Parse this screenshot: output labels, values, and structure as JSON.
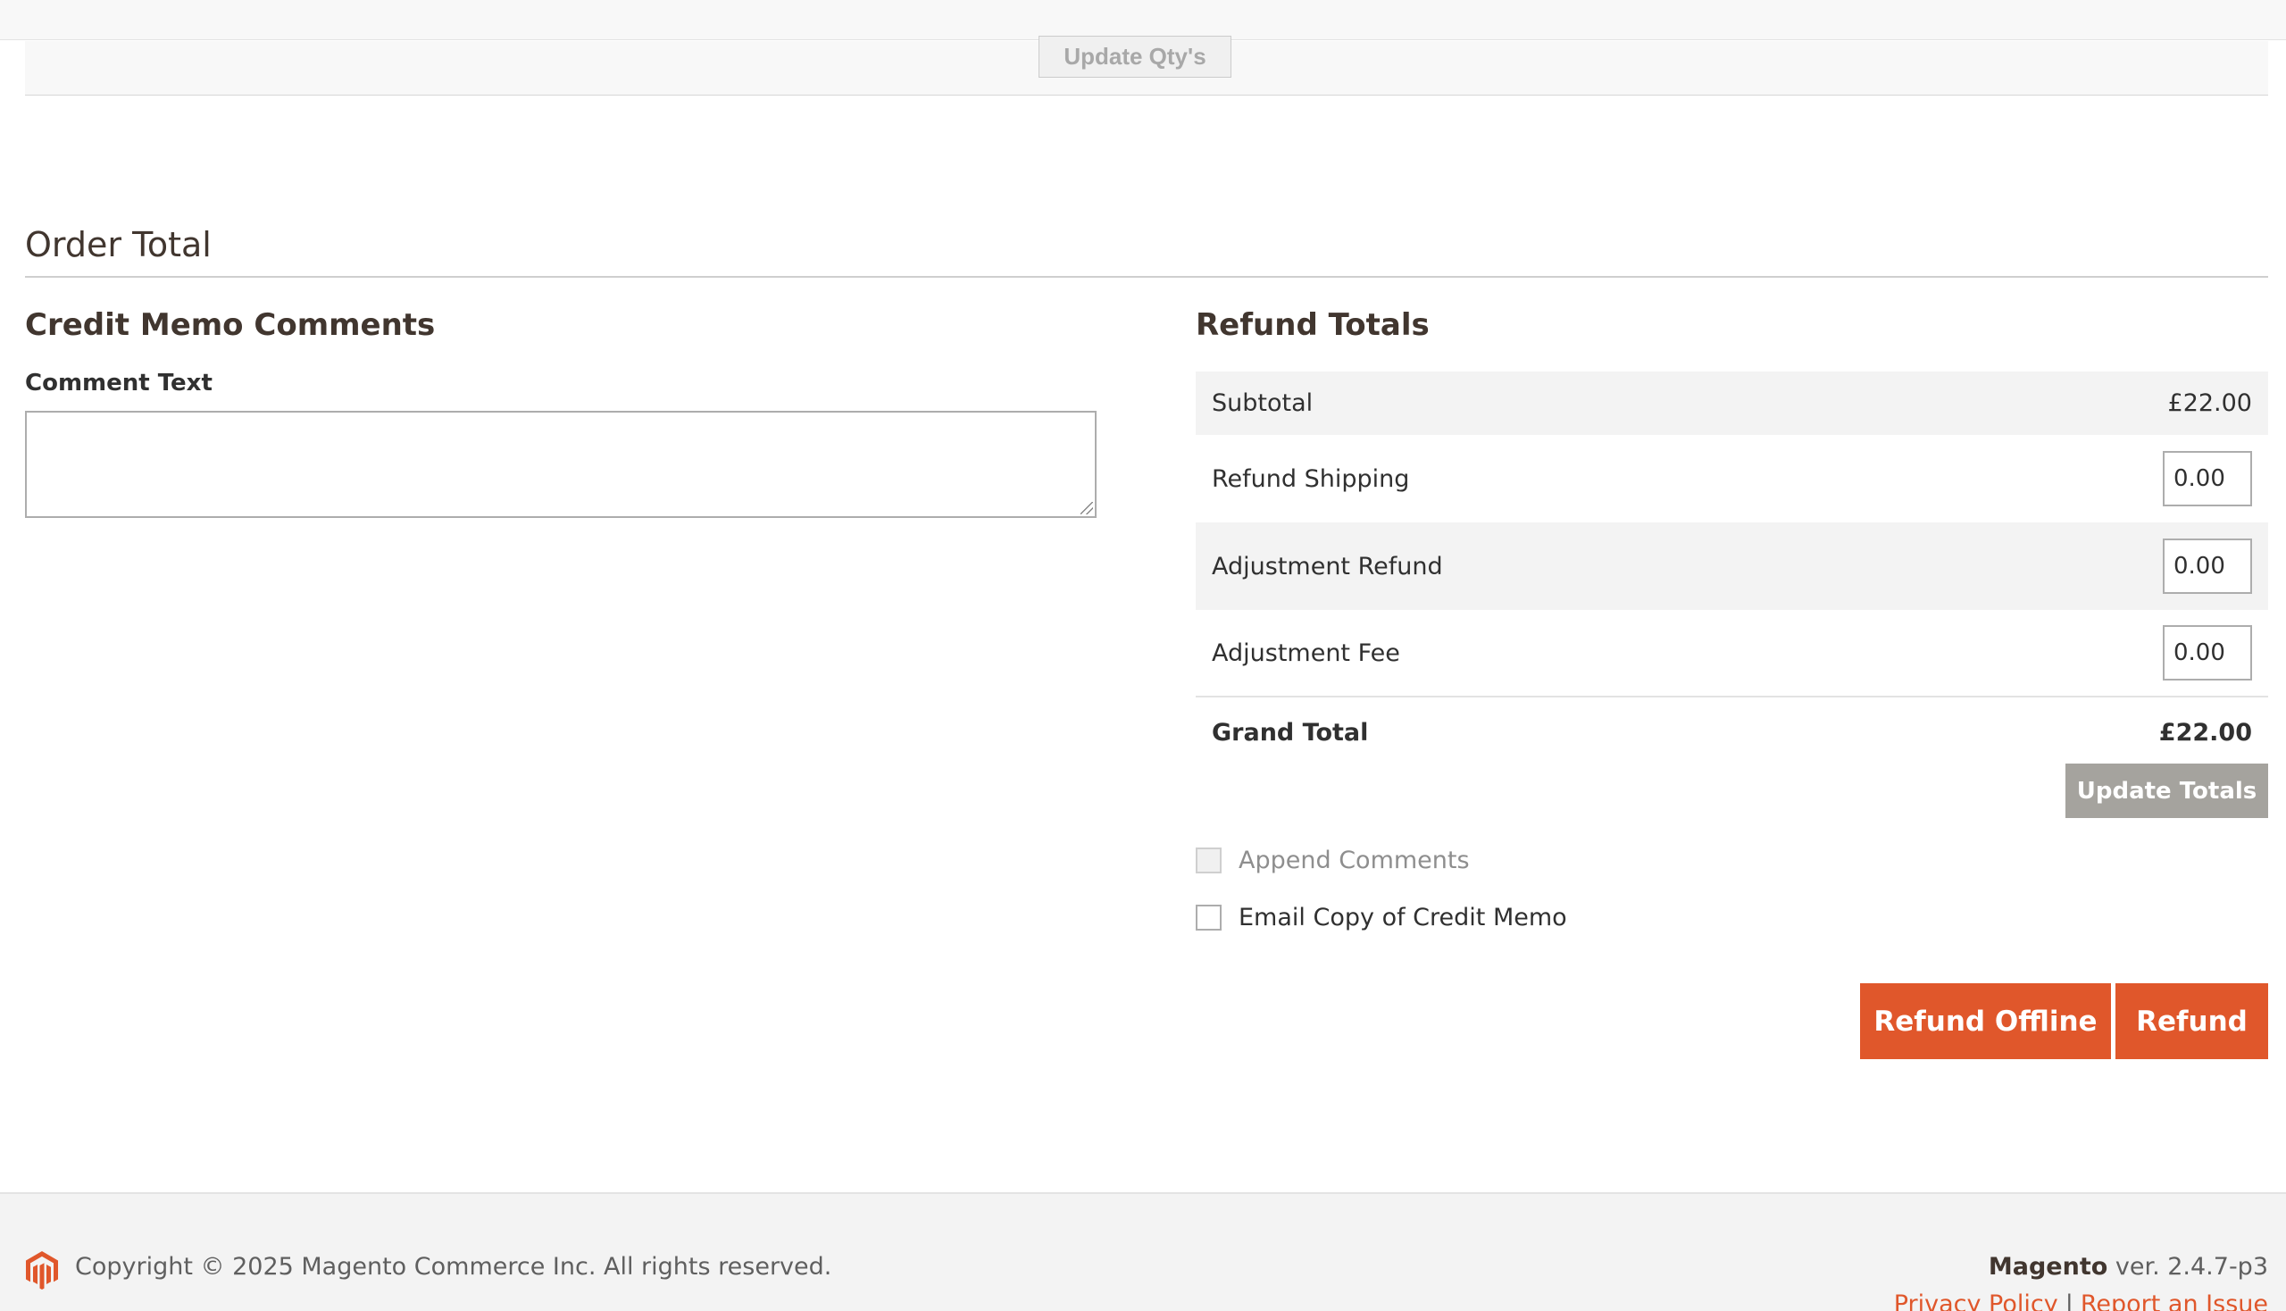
{
  "items": {
    "update_qtys_label": "Update Qty's"
  },
  "order_total": {
    "title": "Order Total"
  },
  "comments": {
    "heading": "Credit Memo Comments",
    "comment_label": "Comment Text",
    "comment_value": ""
  },
  "refund_totals": {
    "heading": "Refund Totals",
    "subtotal_label": "Subtotal",
    "subtotal_value": "£22.00",
    "refund_shipping_label": "Refund Shipping",
    "refund_shipping_value": "0.00",
    "adjustment_refund_label": "Adjustment Refund",
    "adjustment_refund_value": "0.00",
    "adjustment_fee_label": "Adjustment Fee",
    "adjustment_fee_value": "0.00",
    "grand_total_label": "Grand Total",
    "grand_total_value": "£22.00",
    "update_totals_label": "Update Totals",
    "append_comments_label": "Append Comments",
    "email_copy_label": "Email Copy of Credit Memo",
    "refund_offline_label": "Refund Offline",
    "refund_label": "Refund"
  },
  "footer": {
    "copyright": "Copyright © 2025 Magento Commerce Inc. All rights reserved.",
    "brand": "Magento",
    "version": " ver. 2.4.7-p3",
    "privacy_policy": "Privacy Policy",
    "separator": "|",
    "report_issue": "Report an Issue"
  },
  "colors": {
    "accent": "#e0572b",
    "disabled_button": "#a5a39e",
    "heading": "#41362f"
  },
  "icons": {
    "logo": "magento-logo-icon"
  }
}
